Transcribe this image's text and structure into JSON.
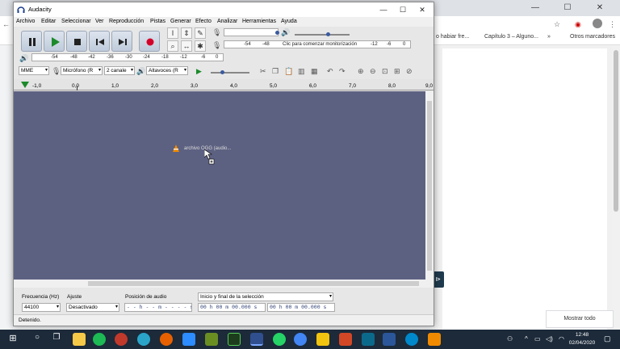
{
  "browser": {
    "bookmarks": [
      "o habiar fre...",
      "Capítulo 3 – Alguno...",
      "»",
      "Otros marcadores"
    ],
    "show_all": "Mostrar todo"
  },
  "audacity": {
    "title": "Audacity",
    "menus": [
      "Archivo",
      "Editar",
      "Seleccionar",
      "Ver",
      "Reproducción",
      "Pistas",
      "Generar",
      "Efecto",
      "Analizar",
      "Herramientas",
      "Ayuda"
    ],
    "meter_labels_play": [
      "-54",
      "-48",
      "-42",
      "-36",
      "-30",
      "-24",
      "-18",
      "-12",
      "-6",
      "0"
    ],
    "meter_labels_rec": [
      "-54",
      "-48"
    ],
    "monitor_text": "Clic para comenzar monitorización",
    "meter_labels_rec_right": [
      "-12",
      "-6",
      "0"
    ],
    "device": {
      "host": "MME",
      "mic": "Micrófono (R",
      "channels": "2 canale",
      "speaker": "Altavoces (R"
    },
    "ruler_ticks": [
      "-1,0",
      "0,0",
      "1,0",
      "2,0",
      "3,0",
      "4,0",
      "5,0",
      "6,0",
      "7,0",
      "8,0",
      "9,0"
    ],
    "drag_label": "archivo OGG (audio...",
    "bottom": {
      "rate_label": "Frecuencia (Hz)",
      "rate_value": "44100",
      "snap_label": "Ajuste",
      "snap_value": "Desactivado",
      "pos_label": "Posición de audio",
      "pos_value": "- - h - - m - - - - s",
      "sel_label": "Inicio y final de la selección",
      "sel_start": "00 h 00 m 00.000 s",
      "sel_end": "00 h 00 m 00.000 s"
    },
    "status": "Detenido."
  },
  "taskbar": {
    "time": "12:48",
    "date": "02/04/2020"
  },
  "colors": {
    "track_bg": "#5d6181",
    "taskbar": "#1c2a3a",
    "record": "#d4002a"
  }
}
